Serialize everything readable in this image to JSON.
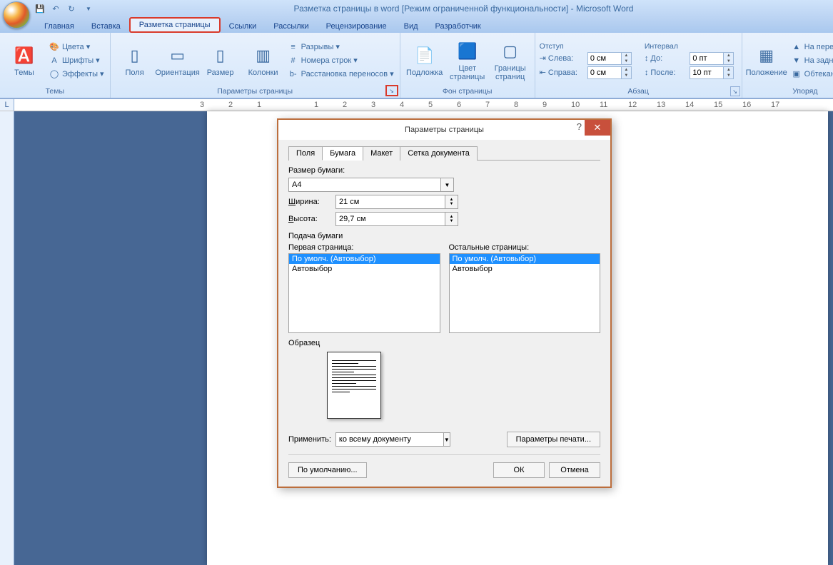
{
  "window_title": "Разметка страницы в word [Режим ограниченной функциональности] - Microsoft Word",
  "tabs": {
    "main": "Главная",
    "insert": "Вставка",
    "layout": "Разметка страницы",
    "refs": "Ссылки",
    "mail": "Рассылки",
    "review": "Рецензирование",
    "view": "Вид",
    "dev": "Разработчик"
  },
  "themes": {
    "btn": "Темы",
    "colors": "Цвета ▾",
    "fonts": "Шрифты ▾",
    "effects": "Эффекты ▾",
    "group": "Темы"
  },
  "page_setup": {
    "margins": "Поля",
    "orient": "Ориентация",
    "size": "Размер",
    "cols": "Колонки",
    "breaks": "Разрывы ▾",
    "linenums": "Номера строк ▾",
    "hyphen": "Расстановка переносов ▾",
    "group": "Параметры страницы"
  },
  "page_bg": {
    "water": "Подложка",
    "color": "Цвет страницы",
    "borders": "Границы страниц",
    "group": "Фон страницы"
  },
  "indent": {
    "title": "Отступ",
    "left_lbl": "Слева:",
    "left_val": "0 см",
    "right_lbl": "Справа:",
    "right_val": "0 см"
  },
  "spacing": {
    "title": "Интервал",
    "before_lbl": "До:",
    "before_val": "0 пт",
    "after_lbl": "После:",
    "after_val": "10 пт"
  },
  "para_group": "Абзац",
  "position": {
    "btn": "Положение",
    "front": "На передний пл",
    "back": "На задний пл",
    "wrap": "Обтекание те",
    "group": "Упоряд"
  },
  "dialog": {
    "title": "Параметры страницы",
    "tab_fields": "Поля",
    "tab_paper": "Бумага",
    "tab_layout": "Макет",
    "tab_grid": "Сетка документа",
    "size_lbl": "Размер бумаги:",
    "size_val": "A4",
    "width_lbl": "Ширина:",
    "width_val": "21 см",
    "height_lbl": "Высота:",
    "height_val": "29,7 см",
    "feed": "Подача бумаги",
    "first_page": "Первая страница:",
    "other_pages": "Остальные страницы:",
    "opt_default": "По умолч. (Автовыбор)",
    "opt_auto": "Автовыбор",
    "sample": "Образец",
    "apply_lbl": "Применить:",
    "apply_val": "ко всему документу",
    "print_opts": "Параметры печати...",
    "default_btn": "По умолчанию...",
    "ok": "ОК",
    "cancel": "Отмена"
  }
}
